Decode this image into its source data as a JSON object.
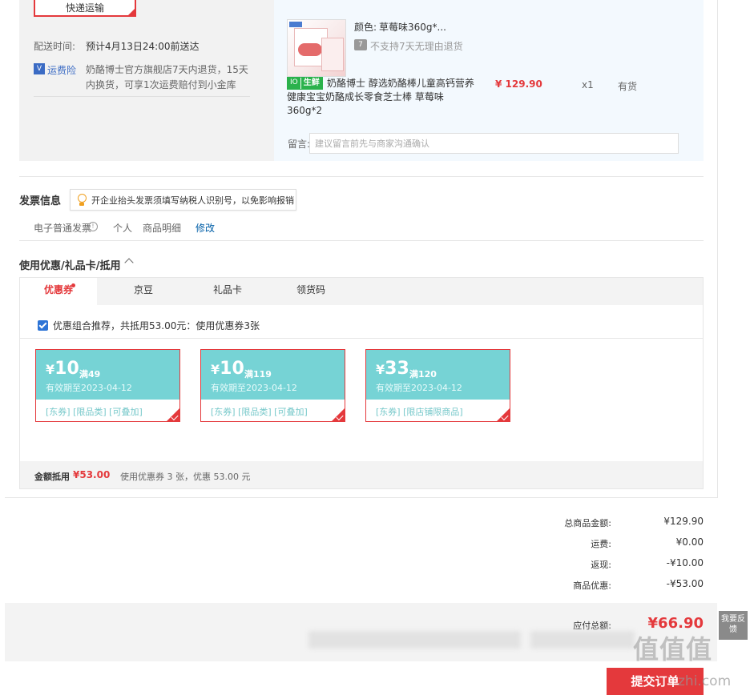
{
  "shipping": {
    "express_label": "快递运输",
    "time_label": "配送时间:",
    "time_value": "预计4月13日24:00前送达",
    "insurance_label": "运费险",
    "insurance_desc": "奶酪博士官方旗舰店7天内退货，15天内换货，可享1次运费赔付到小金库"
  },
  "product": {
    "color_label": "颜色:",
    "color_value": "草莓味360g*...",
    "no_return_text": "不支持7天无理由退货",
    "fresh_badge_icon": "IO",
    "fresh_badge_text": "生鲜",
    "title": "奶酪博士 醇选奶酪棒儿童高钙营养健康宝宝奶酪成长零食芝士棒 草莓味360g*2",
    "price": "¥ 129.90",
    "qty": "x1",
    "stock": "有货"
  },
  "message": {
    "label": "留言:",
    "placeholder": "建议留言前先与商家沟通确认"
  },
  "invoice": {
    "title": "发票信息",
    "tip": "开企业抬头发票须填写纳税人识别号，以免影响报销",
    "type": "电子普通发票",
    "person": "个人",
    "detail": "商品明细",
    "edit": "修改"
  },
  "coupons": {
    "title": "使用优惠/礼品卡/抵用",
    "tabs": [
      {
        "label": "优惠券"
      },
      {
        "label": "京豆"
      },
      {
        "label": "礼品卡"
      },
      {
        "label": "领货码"
      }
    ],
    "combo_text": "优惠组合推荐，共抵用53.00元：使用优惠券3张",
    "cards": [
      {
        "amount": "10",
        "condition": "满49",
        "expiry": "有效期至2023-04-12",
        "tags": "[东券]  [限品类]  [可叠加]"
      },
      {
        "amount": "10",
        "condition": "满119",
        "expiry": "有效期至2023-04-12",
        "tags": "[东券]  [限品类]  [可叠加]"
      },
      {
        "amount": "33",
        "condition": "满120",
        "expiry": "有效期至2023-04-12",
        "tags": "[东券]  [限店铺限商品]"
      }
    ],
    "yen": "¥",
    "summary_label": "金额抵用",
    "summary_value": "¥53.00",
    "summary_desc": "使用优惠券 3 张，优惠 53.00 元"
  },
  "totals": {
    "items": [
      {
        "label": "总商品金额:",
        "value": "¥129.90"
      },
      {
        "label": "运费:",
        "value": "¥0.00"
      },
      {
        "label": "返现:",
        "value": "-¥10.00"
      },
      {
        "label": "商品优惠:",
        "value": "-¥53.00"
      }
    ],
    "pay_label": "应付总额:",
    "pay_value": "¥66.90"
  },
  "submit_label": "提交订单",
  "feedback_label": "我要反馈",
  "watermark": "值值值",
  "watermark_url": "zhi.com",
  "colors": {
    "accent_red": "#e4393c",
    "coupon_teal": "#76d3d5",
    "link_blue": "#005ea7",
    "fresh_green": "#2bb24c"
  }
}
